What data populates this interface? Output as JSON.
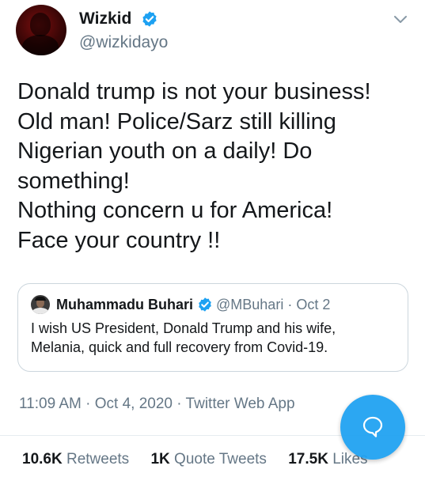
{
  "author": {
    "name": "Wizkid",
    "handle": "@wizkidayo"
  },
  "tweet": {
    "lines": [
      "Donald trump is not your business!",
      "Old man! Police/Sarz still killing",
      "Nigerian youth on a daily! Do",
      "something!",
      "Nothing concern u for America!",
      "Face your country !!"
    ]
  },
  "quote": {
    "name": "Muhammadu Buhari",
    "handle": "@MBuhari",
    "separator": "·",
    "date": "Oct 2",
    "lines": [
      "I wish US President, Donald Trump and his wife,",
      "Melania, quick and full recovery from Covid-19."
    ]
  },
  "meta": {
    "time": "11:09 AM",
    "sep1": "·",
    "date": "Oct 4, 2020",
    "sep2": "·",
    "source": "Twitter Web App"
  },
  "stats": {
    "retweets_count": "10.6K",
    "retweets_label": "Retweets",
    "quotes_count": "1K",
    "quotes_label": "Quote Tweets",
    "likes_count": "17.5K",
    "likes_label": "Likes"
  },
  "icons": {
    "verified": "verified-badge-icon",
    "more": "chevron-down-icon",
    "compose": "speech-bubble-icon"
  },
  "colors": {
    "accent": "#1da1f2",
    "secondary_text": "#657786",
    "primary_text": "#14171a",
    "border": "#ccd6dd"
  }
}
